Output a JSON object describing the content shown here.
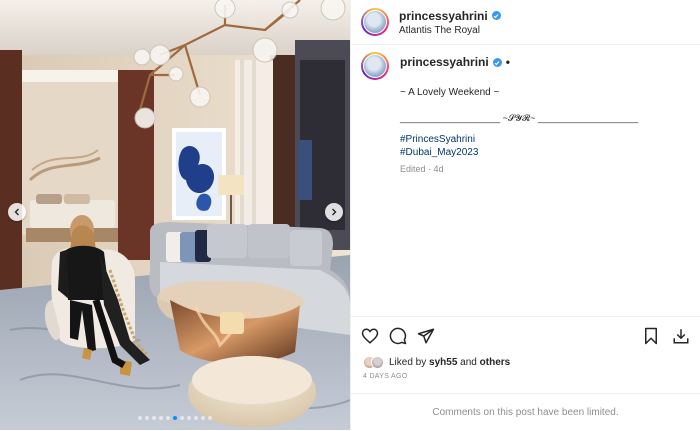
{
  "header": {
    "username": "princessyahrini",
    "location": "Atlantis The Royal"
  },
  "caption": {
    "username": "princessyahrini",
    "bullet": "•",
    "lines": [
      "~ A Lovely Weekend ~",
      "____________________ ~𝓢𝓨𝓡~ ____________________"
    ],
    "hashtags": [
      "#PrincesSyahrini",
      "#Dubai_May2023"
    ],
    "edited": "Edited · 4d"
  },
  "likes": {
    "prefix": "Liked by ",
    "user": "syh55",
    "and": " and ",
    "others": "others"
  },
  "timestamp": "4 DAYS AGO",
  "comments_notice": "Comments on this post have been limited.",
  "carousel": {
    "slides": 11,
    "active_index": 5
  },
  "colors": {
    "verified": "#3897f0",
    "active_dot": "#0095f6",
    "hashtag": "#00376b",
    "muted": "#8e8e8e"
  },
  "icons": {
    "like": "heart-icon",
    "comment": "comment-icon",
    "share": "send-icon",
    "save": "bookmark-icon",
    "download": "download-icon",
    "prev": "chevron-left-icon",
    "next": "chevron-right-icon"
  }
}
